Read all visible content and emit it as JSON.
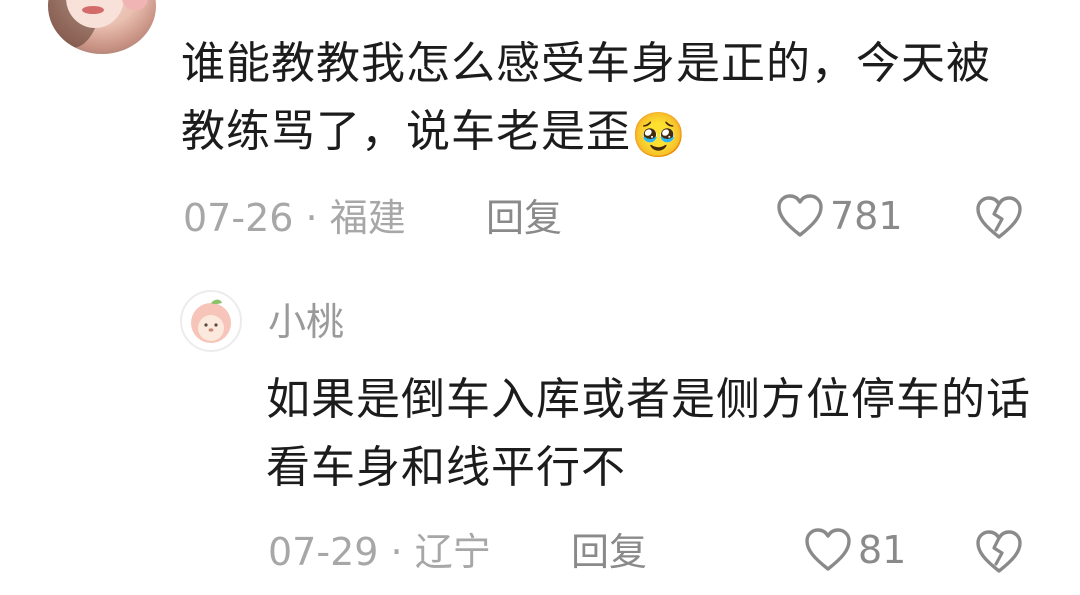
{
  "comment": {
    "text": "谁能教教我怎么感受车身是正的，今天被教练骂了，说车老是歪",
    "emoji": "🥹",
    "date": "07-26",
    "separator": "·",
    "location": "福建",
    "reply_label": "回复",
    "likes": "781"
  },
  "reply": {
    "username": "小桃",
    "text": "如果是倒车入库或者是侧方位停车的话看车身和线平行不",
    "date": "07-29",
    "separator": "·",
    "location": "辽宁",
    "reply_label": "回复",
    "likes": "81"
  },
  "colors": {
    "text": "#1c1c1c",
    "meta": "#a7a7a7",
    "action": "#8a8a8a",
    "background": "#ffffff"
  },
  "icons": {
    "like": "heart-outline-icon",
    "dislike": "broken-heart-icon"
  }
}
